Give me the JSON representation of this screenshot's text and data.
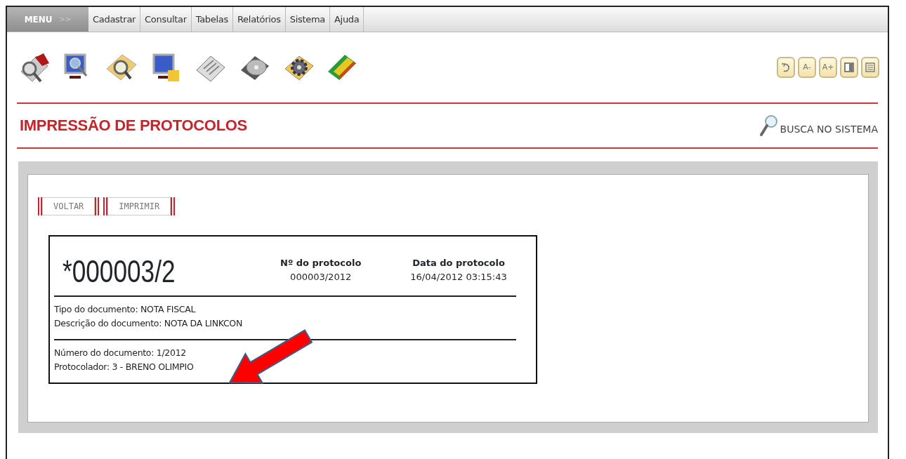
{
  "menu": {
    "label": "MENU",
    "arrow": ">>",
    "items": [
      "Cadastrar",
      "Consultar",
      "Tabelas",
      "Relatórios",
      "Sistema",
      "Ajuda"
    ]
  },
  "view_controls": [
    {
      "kind": "reset"
    },
    {
      "kind": "text",
      "label": "A-"
    },
    {
      "kind": "text",
      "label": "A+"
    },
    {
      "kind": "contrast"
    },
    {
      "kind": "lines"
    }
  ],
  "page_title": "IMPRESSÃO DE PROTOCOLOS",
  "search_link": "BUSCA NO SISTEMA",
  "buttons": [
    "VOLTAR",
    "IMPRIMIR"
  ],
  "protocol": {
    "code": "*000003/2",
    "header": [
      {
        "label": "Nº do protocolo",
        "value": "000003/2012"
      },
      {
        "label": "Data do protocolo",
        "value": "16/04/2012 03:15:43"
      }
    ],
    "sections": [
      [
        "Tipo do documento: NOTA FISCAL",
        "Descrição do documento: NOTA DA LINKCON"
      ],
      [
        "Número do documento: 1/2012",
        "Protocolador: 3 - BRENO OLIMPIO"
      ]
    ]
  }
}
